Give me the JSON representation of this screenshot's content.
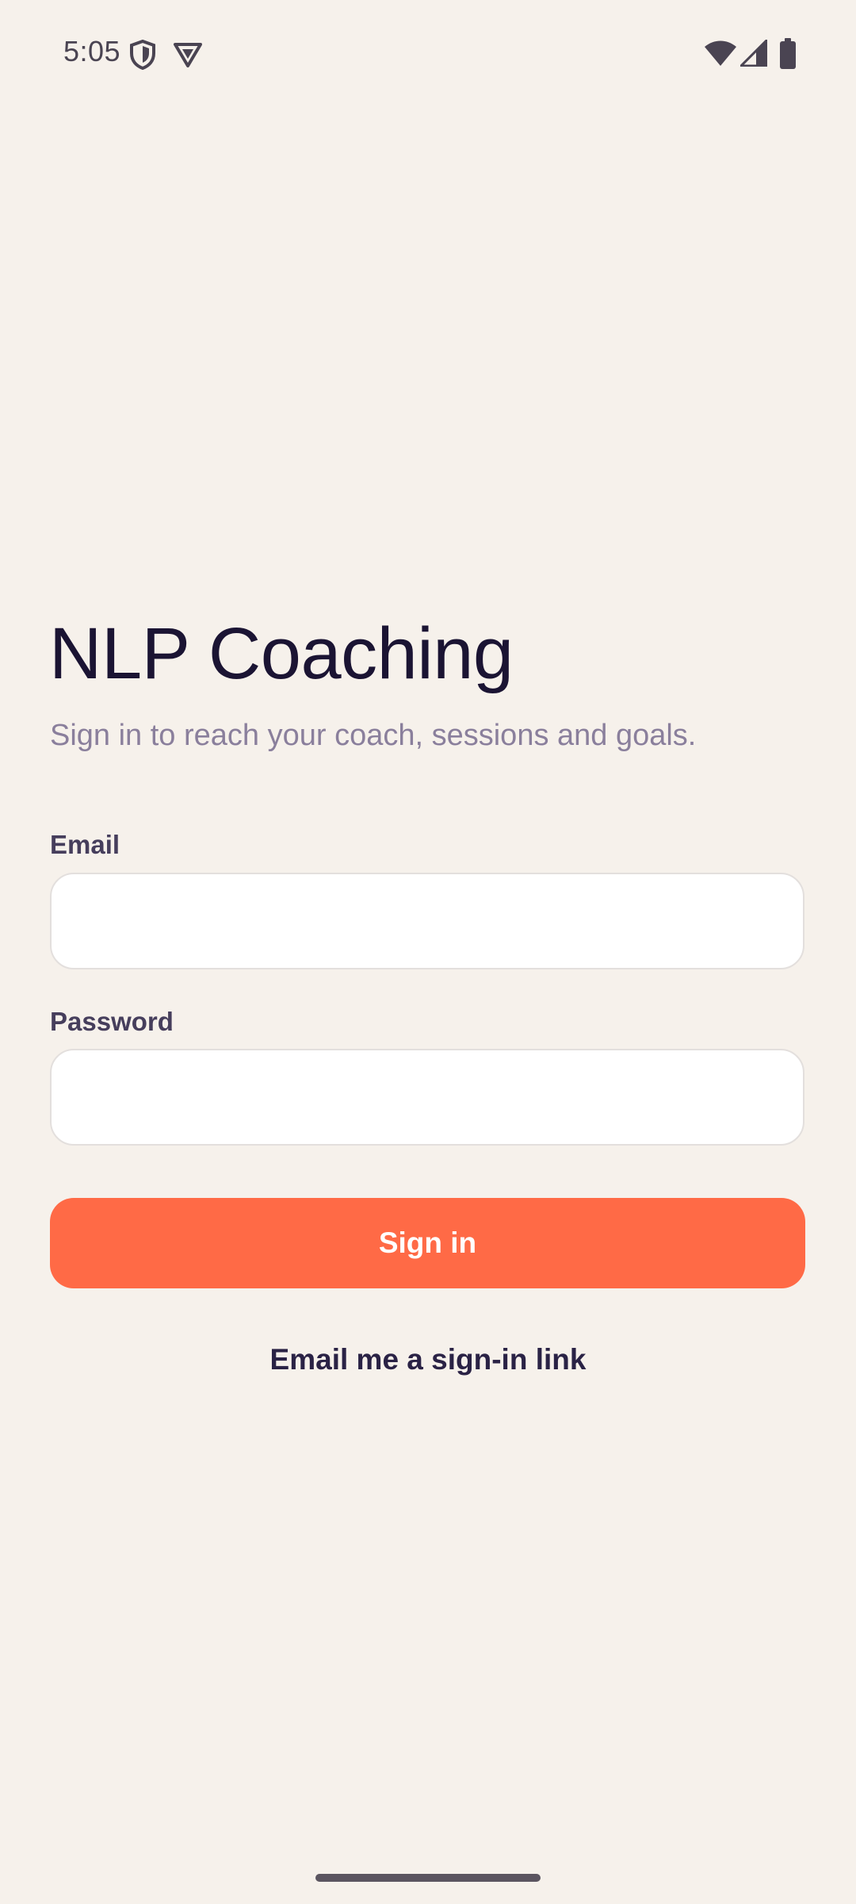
{
  "status_bar": {
    "time": "5:05",
    "left_icons": [
      "shield-icon",
      "vpn-triangle-icon"
    ],
    "right_icons": [
      "wifi-icon",
      "cell-signal-icon",
      "battery-icon"
    ]
  },
  "app": {
    "title": "NLP Coaching",
    "subtitle": "Sign in to reach your coach, sessions and goals."
  },
  "form": {
    "email": {
      "label": "Email",
      "value": "",
      "placeholder": ""
    },
    "password": {
      "label": "Password",
      "value": "",
      "placeholder": ""
    },
    "sign_in_label": "Sign in",
    "magic_link_label": "Email me a sign-in link"
  },
  "colors": {
    "background": "#f6f1eb",
    "accent": "#ff6a46",
    "title": "#1b1433",
    "subtitle": "#8a7f9c",
    "label": "#463e5c",
    "input_border": "#e3dfdd"
  }
}
